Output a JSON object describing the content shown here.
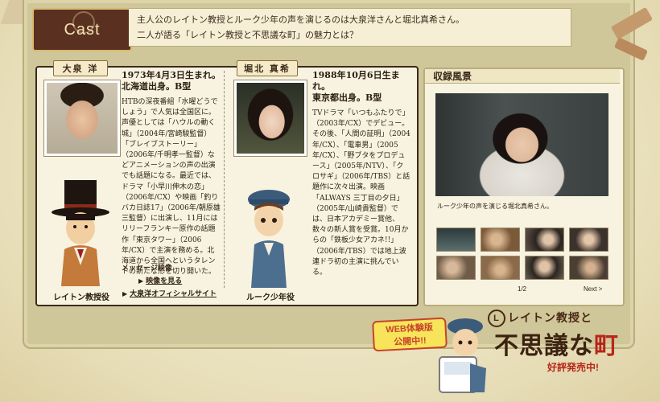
{
  "header": {
    "tab_label": "Cast",
    "intro_line1": "主人公のレイトン教授とルーク少年の声を演じるのは大泉洋さんと堀北真希さん。",
    "intro_line2": "二人が語る「レイトン教授と不思議な町」の魅力とは？"
  },
  "cast": {
    "oizumi": {
      "name": "大泉 洋",
      "bio_head_1": "1973年4月3日生まれ。",
      "bio_head_2": "北海道出身。B型",
      "bio": "HTBの深夜番組「水曜どうでしょう」で人気は全国区に。声優としては「ハウルの動く城」（2004年/宮崎駿監督）「ブレイブストーリー」（2006年/千明孝一監督）などアニメーションの声の出演でも話題になる。最近では、ドラマ「小早川伸木の恋」（2006年/CX）や映画「釣りバカ日誌17」（2006年/朝原雄三監督）に出演し、11月にはリリーフランキー原作の話題作「東京タワー」（2006年/CX）で主演を務める。北海道から全国へというタレントの新たな形を切り開いた。",
      "role": "レイトン教授役",
      "message_label": "メッセージ映像",
      "video_link": "映像を見る",
      "official_link": "大泉洋オフィシャルサイト"
    },
    "horikita": {
      "name": "堀北 真希",
      "bio_head_1": "1988年10月6日生まれ。",
      "bio_head_2": "東京都出身。B型",
      "bio": "TVドラマ「いつもふたりで」（2003年/CX）でデビュー。その後、「人間の証明」（2004年/CX）、「電車男」（2005年/CX）、「野ブタをプロデュース」（2005年/NTV）、「クロサギ」（2006年/TBS）と話題作に次々出演。映画「ALWAYS 三丁目の夕日」（2005年/山崎貴監督）では、日本アカデミー賞他、数々の新人賞を受賞。10月からの「鉄板少女アカネ!!」（2006年/TBS）では地上波連ドラ初の主演に挑んでいる。",
      "role": "ルーク少年役"
    }
  },
  "recording": {
    "title": "収録風景",
    "caption": "ルーク少年の声を演じる堀北真希さん。",
    "pager": "1/2",
    "next": "Next >"
  },
  "promo": {
    "web_badge_line1": "WEB体験版",
    "web_badge_line2": "公開中!!",
    "logo_top": "レイトン教授と",
    "logo_L": "L",
    "logo_main_a": "不思議な",
    "logo_main_b": "町",
    "logo_sub": "好評発売中!"
  }
}
